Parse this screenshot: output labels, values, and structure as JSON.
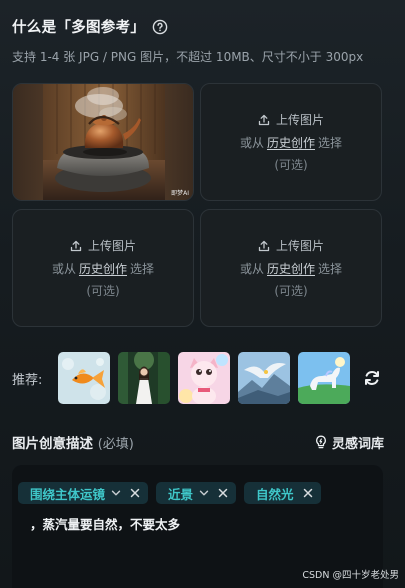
{
  "header": {
    "title": "什么是「多图参考」",
    "help_icon": "help-circle-icon",
    "subtitle": "支持 1-4 张 JPG / PNG 图片，不超过 10MB、尺寸不小于 300px"
  },
  "upload": {
    "upload_label": "上传图片",
    "or_from": "或从",
    "history_link": "历史创作",
    "choose": "选择",
    "optional": "(可选)",
    "slots": [
      {
        "state": "filled",
        "image": "teapot-on-stove-photo",
        "watermark": "即梦AI"
      },
      {
        "state": "empty"
      },
      {
        "state": "empty"
      },
      {
        "state": "empty"
      }
    ]
  },
  "recommend": {
    "label": "推荐:",
    "thumbnails": [
      "goldfish-thumbnail",
      "woman-in-forest-thumbnail",
      "cartoon-cat-thumbnail",
      "eagle-thumbnail",
      "white-horse-thumbnail"
    ],
    "refresh_icon": "refresh-icon"
  },
  "description": {
    "title": "图片创意描述",
    "required": "(必填)",
    "inspiration": "灵感词库",
    "tags": [
      {
        "label": "围绕主体运镜",
        "has_dropdown": true
      },
      {
        "label": "近景",
        "has_dropdown": true
      },
      {
        "label": "自然光",
        "has_dropdown": false
      }
    ],
    "text": "，蒸汽量要自然，不要太多"
  },
  "watermark": "CSDN @四十岁老处男",
  "colors": {
    "accent": "#3fc7c9",
    "tag_bg": "#163038",
    "page_bg": "#161c20"
  }
}
